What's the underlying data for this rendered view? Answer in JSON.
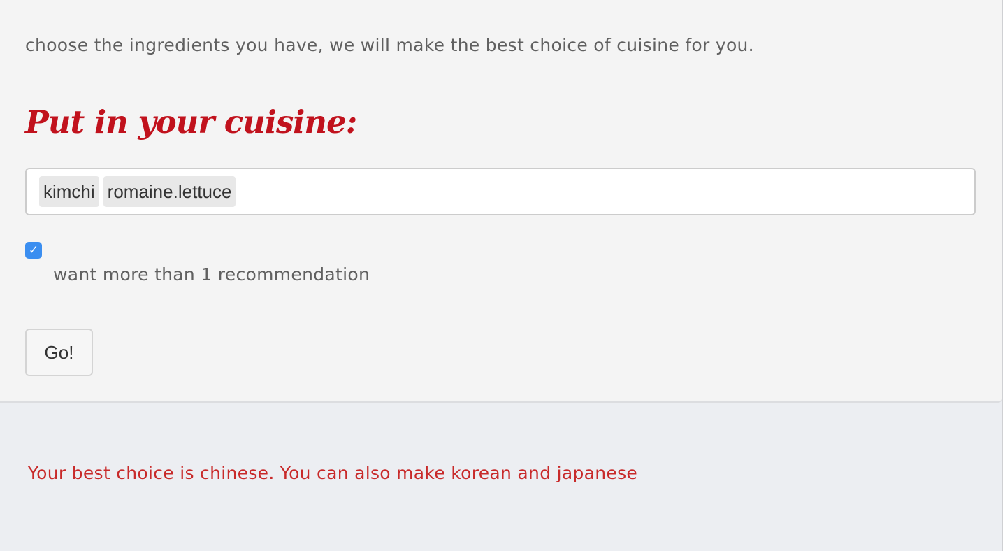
{
  "form": {
    "intro_text": "choose the ingredients you have, we will make the best choice of cuisine for you.",
    "heading": "Put in your cuisine:",
    "ingredients": [
      "kimchi",
      "romaine.lettuce"
    ],
    "checkbox_checked": true,
    "checkbox_mark": "✓",
    "checkbox_label": "want more than 1 recommendation",
    "go_button_label": "Go!"
  },
  "result": {
    "text": "Your best choice is chinese. You can also make korean and japanese"
  },
  "colors": {
    "heading": "#c1121d",
    "result_text": "#c82a2a",
    "checkbox": "#3b8ef0"
  }
}
